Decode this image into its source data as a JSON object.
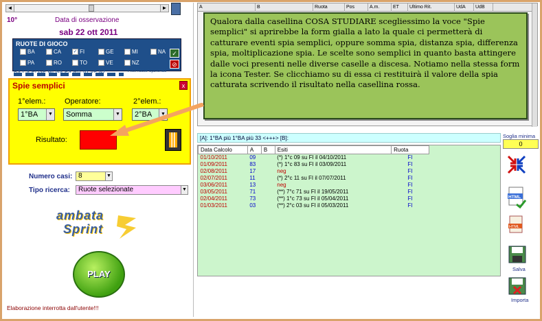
{
  "left": {
    "degree": "10°",
    "observation_label": "Data di osservazione",
    "observation_date": "sab 22 ott 2011",
    "ruote_header": "RUOTE DI GIOCO",
    "ruote": [
      {
        "name": "BA",
        "checked": false
      },
      {
        "name": "CA",
        "checked": false
      },
      {
        "name": "FI",
        "checked": true
      },
      {
        "name": "GE",
        "checked": false
      },
      {
        "name": "MI",
        "checked": false
      },
      {
        "name": "NA",
        "checked": false
      },
      {
        "name": "PA",
        "checked": false
      },
      {
        "name": "RO",
        "checked": false
      },
      {
        "name": "TO",
        "checked": false
      },
      {
        "name": "VE",
        "checked": false
      },
      {
        "name": "NZ",
        "checked": false
      }
    ],
    "abbrev_row": "Ba  Ca  Fi  Ge  Mi  Na  Pa  Ro  To  Ve  Nz",
    "filtri_label": "Filtri ruote opzionali",
    "spie_title": "Spie semplici",
    "spie_close": "x",
    "elem1_label": "1°elem.:",
    "operator_label": "Operatore:",
    "elem2_label": "2°elem.:",
    "elem1_value": "1°BA",
    "operator_value": "Somma",
    "elem2_value": "2°BA",
    "result_label": "Risultato:",
    "numcasi_label": "Numero casi:",
    "numcasi_value": "8",
    "tipo_label": "Tipo ricerca:",
    "tipo_value": "Ruote selezionate",
    "logo_line1": "ambata",
    "logo_line2": "Sprint",
    "play_label": "PLAY",
    "status": "Elaborazione interrotta dall'utente!!!"
  },
  "top_grid": {
    "columns": [
      "A",
      "B",
      "Ruota",
      "Pos",
      "A.m.",
      "ET",
      "Ultimo Rit.",
      "UdA",
      "UdB"
    ]
  },
  "note": "Qualora dalla casellina COSA STUDIARE scegliessimo la voce \"Spie semplici\" si aprirebbe la form gialla a lato la quale ci permetterà di catturare eventi spia semplici, oppure somma spia, distanza spia, differenza spia, moltiplicazione spia. Le scelte sono semplici in quanto basta attingere dalle voci presenti nelle diverse caselle a discesa. Notiamo nella stessa form la icona Tester. Se clicchiamo su di essa ci restituirà il valore della spia catturata scrivendo il risultato nella casellina rossa.",
  "ab_row": "[A]: 1°BA più  1°BA  più 33 <+++> [B]:",
  "soglia_label": "Soglia minima",
  "soglia_value": "0",
  "results": {
    "headers": [
      "Data Calcolo",
      "A",
      "B",
      "Esiti",
      "Ruota"
    ],
    "rows": [
      {
        "date": "01/10/2011",
        "a": "09",
        "b": "",
        "esito": "(*) 1°c 09 su FI il 04/10/2011",
        "ruota": "FI",
        "neg": false
      },
      {
        "date": "01/09/2011",
        "a": "83",
        "b": "",
        "esito": "(*) 1°c 83 su FI il 03/09/2011",
        "ruota": "FI",
        "neg": false
      },
      {
        "date": "02/08/2011",
        "a": "17",
        "b": "",
        "esito": "neg",
        "ruota": "FI",
        "neg": true
      },
      {
        "date": "02/07/2011",
        "a": "11",
        "b": "",
        "esito": "(*) 2°c 11 su FI il 07/07/2011",
        "ruota": "FI",
        "neg": false
      },
      {
        "date": "03/06/2011",
        "a": "13",
        "b": "",
        "esito": "neg",
        "ruota": "FI",
        "neg": true
      },
      {
        "date": "03/05/2011",
        "a": "71",
        "b": "",
        "esito": "(**) 7°c 71 su FI il 19/05/2011",
        "ruota": "FI",
        "neg": false
      },
      {
        "date": "02/04/2011",
        "a": "73",
        "b": "",
        "esito": "(**) 1°c 73 su FI il 05/04/2011",
        "ruota": "FI",
        "neg": false
      },
      {
        "date": "01/03/2011",
        "a": "03",
        "b": "",
        "esito": "(**) 2°c 03 su FI il 05/03/2011",
        "ruota": "FI",
        "neg": false
      }
    ]
  },
  "side": {
    "salva_label": "Salva",
    "importa_label": "Importa"
  }
}
